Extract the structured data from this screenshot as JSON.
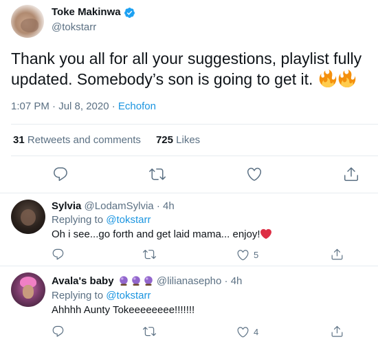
{
  "tweet": {
    "author_name": "Toke Makinwa",
    "author_handle": "@tokstarr",
    "text": "Thank you all for all your suggestions, playlist fully updated. Somebody’s son is going to get it.",
    "time": "1:07 PM · Jul 8, 2020 · ",
    "source": "Echofon",
    "retweets_count": "31",
    "retweets_label": "Retweets and comments",
    "likes_count": "725",
    "likes_label": "Likes",
    "emoji_icons": [
      "fire-icon",
      "fire-icon"
    ]
  },
  "replies": [
    {
      "name": "Sylvia",
      "handle": "@LodamSylvia · 4h",
      "replying_prefix": "Replying to ",
      "replying_to": "@tokstarr",
      "text": "Oh i see...go forth and get laid mama... enjoy!",
      "like_count": "5"
    },
    {
      "name": "Avala's baby",
      "handle": "@lilianasepho · 4h",
      "replying_prefix": "Replying to ",
      "replying_to": "@tokstarr",
      "text": "Ahhhh Aunty Tokeeeeeeee!!!!!!!",
      "like_count": "4"
    }
  ],
  "colors": {
    "accent": "#1b95e0",
    "muted": "#5b7083",
    "text": "#0f1419",
    "divider": "#e6ecf0",
    "heart": "#e0245e"
  }
}
